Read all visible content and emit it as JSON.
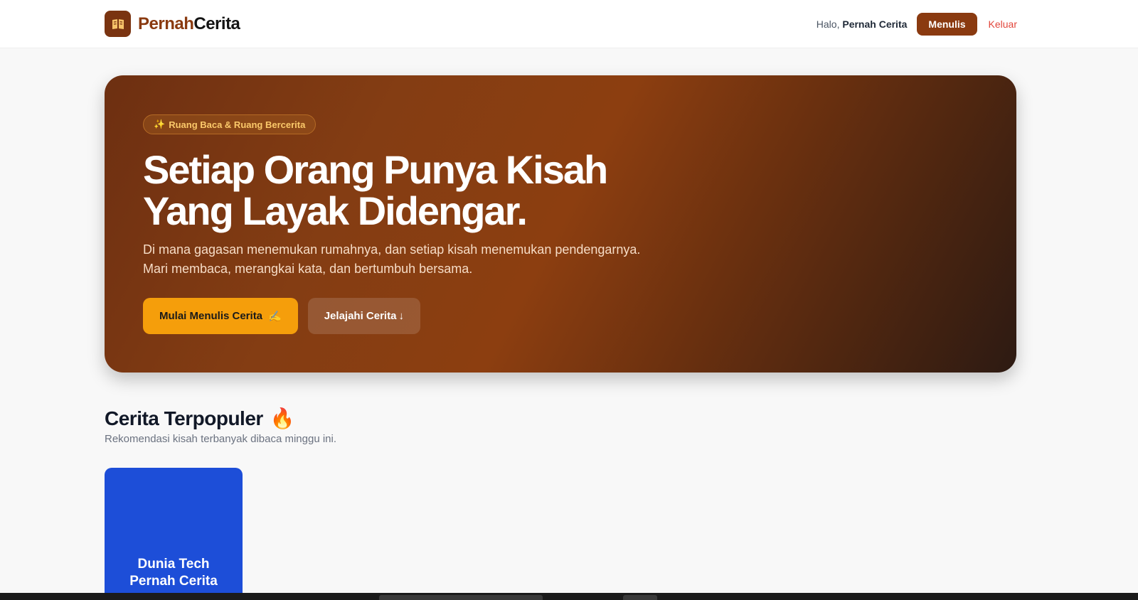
{
  "navbar": {
    "brand_part1": "Pernah",
    "brand_part2": "Cerita",
    "logo_icon": "open-book-icon",
    "greeting": "Halo,",
    "user_name": "Pernah Cerita",
    "write_button": "Menulis",
    "logout_link": "Keluar",
    "brand_color": "#8a3a10",
    "logout_color": "#e2453a"
  },
  "hero": {
    "badge_icon": "✨",
    "badge_text": "Ruang Baca & Ruang Bercerita",
    "title_line1": "Setiap Orang Punya Kisah",
    "title_line2": "Yang Layak Didengar.",
    "subtitle_line1": "Di mana gagasan menemukan rumahnya, dan setiap kisah menemukan pendengarnya.",
    "subtitle_line2": "Mari membaca, merangkai kata, dan bertumbuh bersama.",
    "primary_button": "Mulai Menulis Cerita",
    "primary_button_icon": "✍️",
    "secondary_button": "Jelajahi Cerita",
    "secondary_button_icon": "↓",
    "accent_color": "#f59e0b"
  },
  "popular": {
    "title": "Cerita Terpopuler",
    "title_icon": "🔥",
    "subtitle": "Rekomendasi kisah terbanyak dibaca minggu ini.",
    "cards": [
      {
        "title_line1": "Dunia Tech",
        "title_line2": "Pernah Cerita",
        "color": "#1d4ed8"
      }
    ]
  }
}
